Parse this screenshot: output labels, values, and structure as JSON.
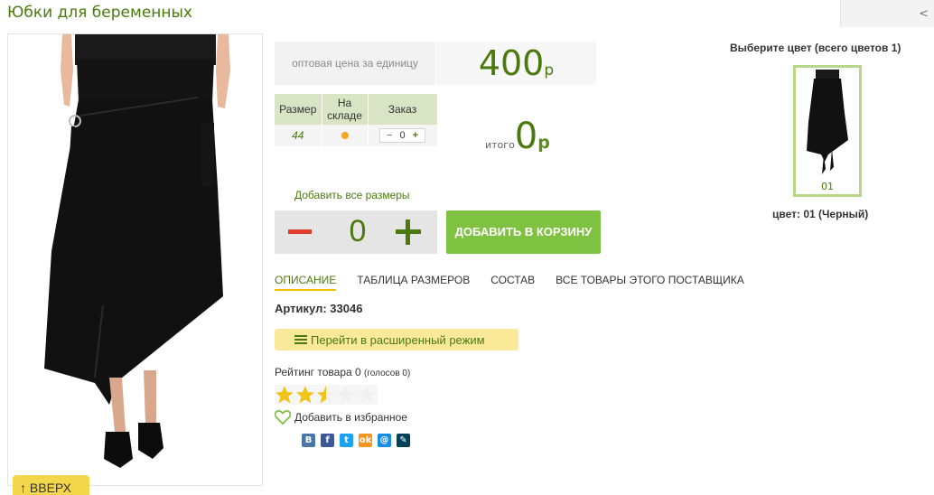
{
  "page": {
    "title": "Юбки для беременных",
    "back_symbol": "<"
  },
  "product": {
    "price_caption": "оптовая цена за единицу",
    "price_value": "400",
    "price_unit": "р",
    "sizes_table": {
      "headers": [
        "Размер",
        "На складе",
        "Заказ"
      ],
      "rows": [
        {
          "size": "44",
          "in_stock": true,
          "order_qty": "0"
        }
      ]
    },
    "total_label": "итого",
    "total_value": "0",
    "total_unit": "р",
    "add_all_label": "Добавить все размеры",
    "quantity": "0",
    "add_to_cart_label": "ДОБАВИТЬ В КОРЗИНУ",
    "tabs": [
      "ОПИСАНИЕ",
      "ТАБЛИЦА РАЗМЕРОВ",
      "СОСТАВ",
      "ВСЕ ТОВАРЫ ЭТОГО ПОСТАВЩИКА"
    ],
    "active_tab": "ОПИСАНИЕ",
    "article": "Артикул: 33046",
    "advanced_mode_label": "Перейти в расширенный режим",
    "rating_text": "Рейтинг товара 0",
    "rating_votes": "(голосов 0)",
    "rating_stars": 2.5,
    "rating_max": 5,
    "favorite_label": "Добавить в избранное",
    "social_icons": [
      {
        "name": "vk-icon",
        "glyph": "В",
        "color": "#4a76a8"
      },
      {
        "name": "facebook-icon",
        "glyph": "f",
        "color": "#3b5998"
      },
      {
        "name": "twitter-icon",
        "glyph": "t",
        "color": "#1da1f2"
      },
      {
        "name": "odnoklassniki-icon",
        "glyph": "ok",
        "color": "#f7931e"
      },
      {
        "name": "mail-icon",
        "glyph": "@",
        "color": "#168de2"
      },
      {
        "name": "livejournal-icon",
        "glyph": "✎",
        "color": "#004359"
      }
    ]
  },
  "colors": {
    "heading": "Выберите цвет (всего цветов 1)",
    "items": [
      {
        "code": "01"
      }
    ],
    "selected_label": "цвет: 01 (Черный)"
  },
  "up_button_label": "↑ ВВЕРХ",
  "accent_color": "#4a7a0e"
}
